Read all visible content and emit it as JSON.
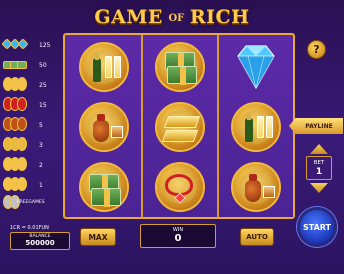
{
  "title": {
    "main": "GAME",
    "of": "OF",
    "end": "RICH"
  },
  "paytable": {
    "rows": [
      {
        "symbol": "diamond-icon",
        "value": "125",
        "color": "#3fb5f0"
      },
      {
        "symbol": "cash-icon",
        "value": "50",
        "color": "#6fae5a"
      },
      {
        "symbol": "gold-bar-icon",
        "value": "25",
        "color": "#f2c24a"
      },
      {
        "symbol": "necklace-icon",
        "value": "15",
        "color": "#d02020"
      },
      {
        "symbol": "cognac-icon",
        "value": "5",
        "color": "#c0501a"
      },
      {
        "symbol": "champagne-icon",
        "value": "3",
        "color": "#f2c24a"
      },
      {
        "symbol": "coin-icon",
        "value": "2",
        "color": "#f2c24a"
      },
      {
        "symbol": "coin-icon",
        "value": "1",
        "color": "#f2c24a"
      }
    ],
    "free_label": "FREEGAMES"
  },
  "reels": [
    [
      "champagne-icon",
      "cognac-icon",
      "cash-icon"
    ],
    [
      "cash-icon",
      "gold-bar-icon",
      "necklace-icon"
    ],
    [
      "diamond-icon",
      "champagne-icon",
      "cognac-icon"
    ]
  ],
  "controls": {
    "help_label": "?",
    "payline_label": "PAYLINE",
    "bet_label": "BET",
    "bet_value": "1",
    "start_label": "START",
    "rate_text": "1CR = 0.01FUN",
    "balance_label": "BALANCE",
    "balance_value": "500000",
    "max_label": "MAX",
    "win_label": "WIN",
    "win_value": "0",
    "auto_label": "AUTO"
  },
  "colors": {
    "background": "#3a1a78",
    "gold": "#e8a93a",
    "start_blue": "#1a34b5"
  }
}
